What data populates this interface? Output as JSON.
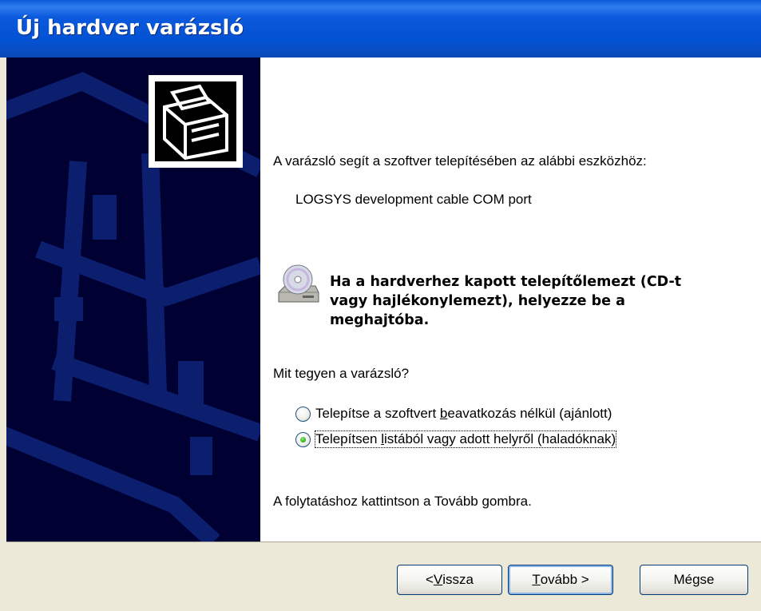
{
  "window": {
    "title": "Új hardver varázsló"
  },
  "main": {
    "intro": "A varázsló segít a szoftver telepítésében az alábbi eszközhöz:",
    "device_name": "LOGSYS development cable COM port",
    "cd_message_lines": [
      "Ha a hardverhez kapott telepítőlemezt (CD-t",
      "vagy hajlékonylemezt), helyezze be a",
      "meghajtóba."
    ],
    "question": "Mit tegyen a varázsló?",
    "options": [
      {
        "pre": "Telepítse a szoftvert ",
        "key": "b",
        "post": "eavatkozás nélkül (ajánlott)",
        "checked": false
      },
      {
        "pre": "Telepítsen ",
        "key": "l",
        "post": "istából vagy adott helyről (haladóknak)",
        "checked": true
      }
    ],
    "continue_text": "A folytatáshoz kattintson a Tovább gombra."
  },
  "buttons": {
    "back": {
      "pre": "< ",
      "key": "V",
      "post": "issza"
    },
    "next": {
      "pre": "",
      "key": "T",
      "post": "ovább >"
    },
    "cancel": {
      "label": "Mégse"
    }
  },
  "icons": {
    "hardware": "hardware-card-icon",
    "cd": "cd-drive-icon"
  },
  "colors": {
    "title_bar": "#0452d4",
    "side_panel": "#000033",
    "dialog_bg": "#ece9d8",
    "button_border": "#003c74"
  }
}
